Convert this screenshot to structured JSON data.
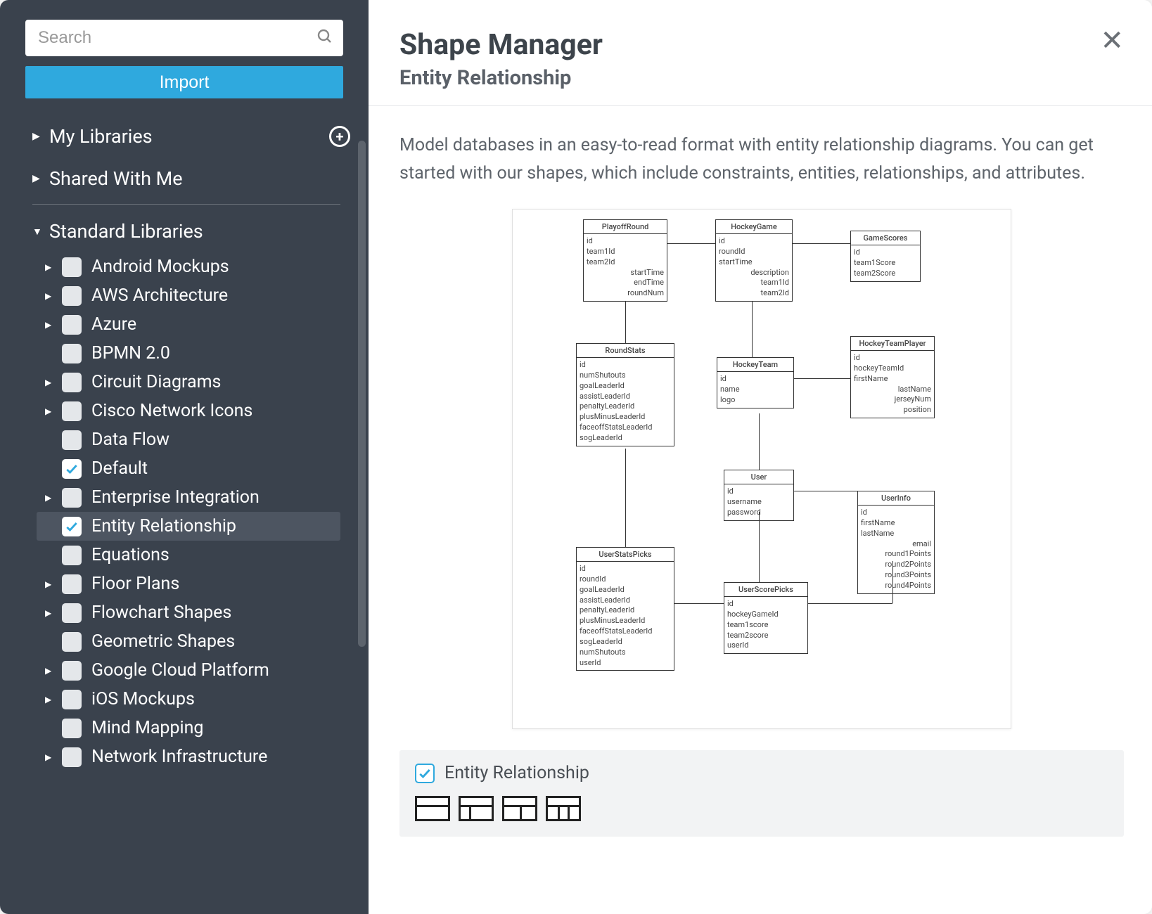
{
  "sidebar": {
    "search_placeholder": "Search",
    "import_label": "Import",
    "sections": {
      "my_libraries": "My Libraries",
      "shared_with_me": "Shared With Me",
      "standard_libraries": "Standard Libraries"
    },
    "items": [
      {
        "label": "Android Mockups",
        "caret": true,
        "checked": false,
        "selected": false
      },
      {
        "label": "AWS Architecture",
        "caret": true,
        "checked": false,
        "selected": false
      },
      {
        "label": "Azure",
        "caret": true,
        "checked": false,
        "selected": false
      },
      {
        "label": "BPMN 2.0",
        "caret": false,
        "checked": false,
        "selected": false
      },
      {
        "label": "Circuit Diagrams",
        "caret": true,
        "checked": false,
        "selected": false
      },
      {
        "label": "Cisco Network Icons",
        "caret": true,
        "checked": false,
        "selected": false
      },
      {
        "label": "Data Flow",
        "caret": false,
        "checked": false,
        "selected": false
      },
      {
        "label": "Default",
        "caret": false,
        "checked": true,
        "selected": false
      },
      {
        "label": "Enterprise Integration",
        "caret": true,
        "checked": false,
        "selected": false
      },
      {
        "label": "Entity Relationship",
        "caret": false,
        "checked": true,
        "selected": true
      },
      {
        "label": "Equations",
        "caret": false,
        "checked": false,
        "selected": false
      },
      {
        "label": "Floor Plans",
        "caret": true,
        "checked": false,
        "selected": false
      },
      {
        "label": "Flowchart Shapes",
        "caret": true,
        "checked": false,
        "selected": false
      },
      {
        "label": "Geometric Shapes",
        "caret": false,
        "checked": false,
        "selected": false
      },
      {
        "label": "Google Cloud Platform",
        "caret": true,
        "checked": false,
        "selected": false
      },
      {
        "label": "iOS Mockups",
        "caret": true,
        "checked": false,
        "selected": false
      },
      {
        "label": "Mind Mapping",
        "caret": false,
        "checked": false,
        "selected": false
      },
      {
        "label": "Network Infrastructure",
        "caret": true,
        "checked": false,
        "selected": false
      }
    ]
  },
  "main": {
    "title": "Shape Manager",
    "subtitle": "Entity Relationship",
    "description": "Model databases in an easy-to-read format with entity relationship diagrams. You can get started with our shapes, which include constraints, entities, relationships, and attributes.",
    "footer_label": "Entity Relationship"
  },
  "erd": {
    "tables": [
      {
        "name": "PlayoffRound",
        "fields_left": [
          "id",
          "team1Id",
          "team2Id"
        ],
        "fields_right": [
          "startTime",
          "endTime",
          "roundNum"
        ]
      },
      {
        "name": "HockeyGame",
        "fields_left": [
          "id",
          "roundId",
          "startTime"
        ],
        "fields_right": [
          "description",
          "team1Id",
          "team2Id"
        ]
      },
      {
        "name": "GameScores",
        "fields_left": [
          "id",
          "team1Score",
          "team2Score"
        ],
        "fields_right": []
      },
      {
        "name": "RoundStats",
        "fields_left": [
          "id",
          "numShutouts",
          "goalLeaderId",
          "assistLeaderId",
          "penaltyLeaderId",
          "plusMinusLeaderId",
          "faceoffStatsLeaderId",
          "sogLeaderId"
        ],
        "fields_right": []
      },
      {
        "name": "HockeyTeam",
        "fields_left": [
          "id",
          "name",
          "logo"
        ],
        "fields_right": []
      },
      {
        "name": "HockeyTeamPlayer",
        "fields_left": [
          "id",
          "hockeyTeamId",
          "firstName"
        ],
        "fields_right": [
          "lastName",
          "jerseyNum",
          "position"
        ]
      },
      {
        "name": "User",
        "fields_left": [
          "id",
          "username",
          "password"
        ],
        "fields_right": []
      },
      {
        "name": "UserInfo",
        "fields_left": [
          "id",
          "firstName",
          "lastName"
        ],
        "fields_right": [
          "email",
          "round1Points",
          "round2Points",
          "round3Points",
          "round4Points"
        ]
      },
      {
        "name": "UserStatsPicks",
        "fields_left": [
          "id",
          "roundId",
          "goalLeaderId",
          "assistLeaderId",
          "penaltyLeaderId",
          "plusMinusLeaderId",
          "faceoffStatsLeaderId",
          "sogLeaderId",
          "numShutouts",
          "userId"
        ],
        "fields_right": []
      },
      {
        "name": "UserScorePicks",
        "fields_left": [
          "id",
          "hockeyGameId",
          "team1score",
          "team2score",
          "userId"
        ],
        "fields_right": []
      }
    ]
  }
}
